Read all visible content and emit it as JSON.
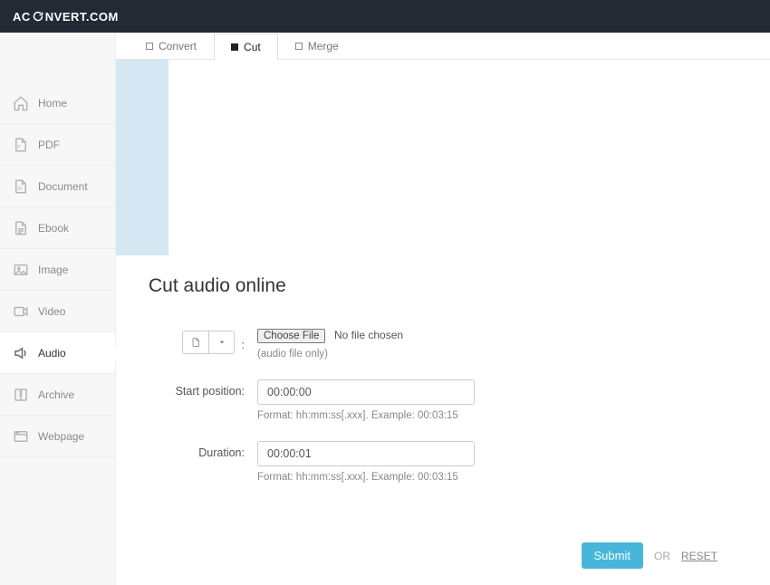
{
  "brand": {
    "pre": "AC",
    "post": "NVERT.COM"
  },
  "sidebar": {
    "items": [
      {
        "label": "Home"
      },
      {
        "label": "PDF"
      },
      {
        "label": "Document"
      },
      {
        "label": "Ebook"
      },
      {
        "label": "Image"
      },
      {
        "label": "Video"
      },
      {
        "label": "Audio"
      },
      {
        "label": "Archive"
      },
      {
        "label": "Webpage"
      }
    ]
  },
  "tabs": {
    "convert": "Convert",
    "cut": "Cut",
    "merge": "Merge"
  },
  "page": {
    "title": "Cut audio online"
  },
  "form": {
    "file": {
      "colon": ":",
      "choose_label": "Choose File",
      "status": "No file chosen",
      "hint": "(audio file only)"
    },
    "start": {
      "label": "Start position:",
      "value": "00:00:00",
      "hint": "Format: hh:mm:ss[.xxx]. Example: 00:03:15"
    },
    "duration": {
      "label": "Duration:",
      "value": "00:00:01",
      "hint": "Format: hh:mm:ss[.xxx]. Example: 00:03:15"
    }
  },
  "actions": {
    "submit": "Submit",
    "or": "OR",
    "reset": "RESET"
  }
}
